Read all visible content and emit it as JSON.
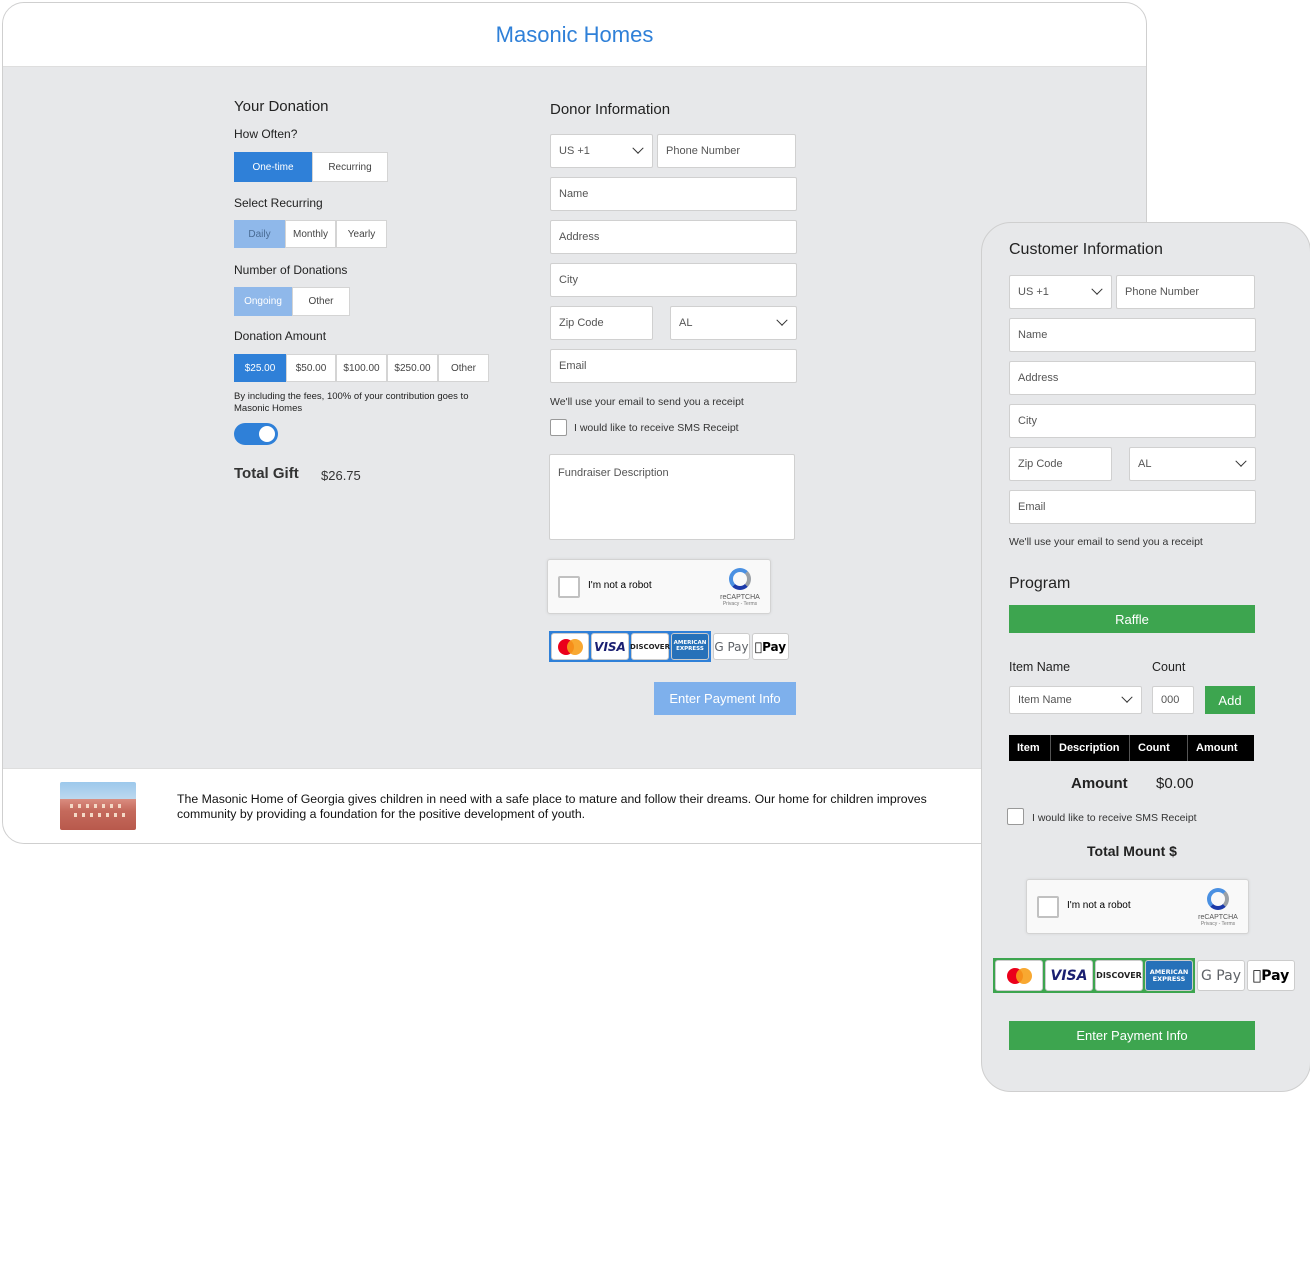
{
  "app": {
    "title": "Masonic Homes"
  },
  "donation": {
    "title": "Your Donation",
    "how_often": {
      "label": "How Often?",
      "options": [
        "One-time",
        "Recurring"
      ],
      "selected": "One-time"
    },
    "select_recurring": {
      "label": "Select Recurring",
      "options": [
        "Daily",
        "Monthly",
        "Yearly"
      ],
      "selected": "Daily"
    },
    "number_of_donations": {
      "label": "Number of Donations",
      "options": [
        "Ongoing",
        "Other"
      ],
      "selected": "Ongoing"
    },
    "amount": {
      "label": "Donation Amount",
      "options": [
        "$25.00",
        "$50.00",
        "$100.00",
        "$250.00",
        "Other"
      ],
      "selected": "$25.00"
    },
    "fees_note": "By including the fees, 100% of your contribution goes to Masonic Homes",
    "fees_toggle_on": true,
    "total_label": "Total Gift",
    "total_value": "$26.75"
  },
  "donor": {
    "title": "Donor Information",
    "country_code": "US +1",
    "phone_placeholder": "Phone Number",
    "name_placeholder": "Name",
    "address_placeholder": "Address",
    "city_placeholder": "City",
    "zip_placeholder": "Zip Code",
    "state": "AL",
    "email_placeholder": "Email",
    "email_note": "We'll use your email to send you a receipt",
    "sms_label": "I would like to receive SMS Receipt",
    "fundraiser_placeholder": "Fundraiser Description",
    "captcha": {
      "label": "I'm not a robot",
      "brand": "reCAPTCHA",
      "terms": "Privacy - Terms"
    },
    "submit_label": "Enter Payment Info"
  },
  "payment_methods": {
    "mastercard": "MasterCard",
    "visa": "VISA",
    "discover": "DISCOVER",
    "amex": "AMERICAN EXPRESS",
    "gpay": "G Pay",
    "applepay": "Pay"
  },
  "footer": {
    "description": "The Masonic Home of Georgia gives children in need with a safe place to mature and follow their dreams. Our home for children improves community by providing a foundation for the positive development of youth."
  },
  "customer": {
    "title": "Customer Information",
    "country_code": "US +1",
    "phone_placeholder": "Phone Number",
    "name_placeholder": "Name",
    "address_placeholder": "Address",
    "city_placeholder": "City",
    "zip_placeholder": "Zip Code",
    "state": "AL",
    "email_placeholder": "Email",
    "email_note": "We'll use your email to send you a receipt",
    "program": {
      "title": "Program",
      "selected": "Raffle",
      "item_name_label": "Item Name",
      "count_label": "Count",
      "item_placeholder": "Item Name",
      "count_placeholder": "000",
      "add_label": "Add",
      "table_headers": [
        "Item",
        "Description",
        "Count",
        "Amount"
      ],
      "amount_label": "Amount",
      "amount_value": "$0.00"
    },
    "sms_label": "I would like to receive SMS Receipt",
    "total_label": "Total Mount $",
    "captcha": {
      "label": "I'm not a robot",
      "brand": "reCAPTCHA",
      "terms": "Privacy - Terms"
    },
    "submit_label": "Enter Payment Info"
  },
  "colors": {
    "brand_blue": "#2f80d8",
    "light_blue": "#8fb8ea",
    "green": "#3da54f",
    "panel_bg": "#e7e8ea"
  }
}
